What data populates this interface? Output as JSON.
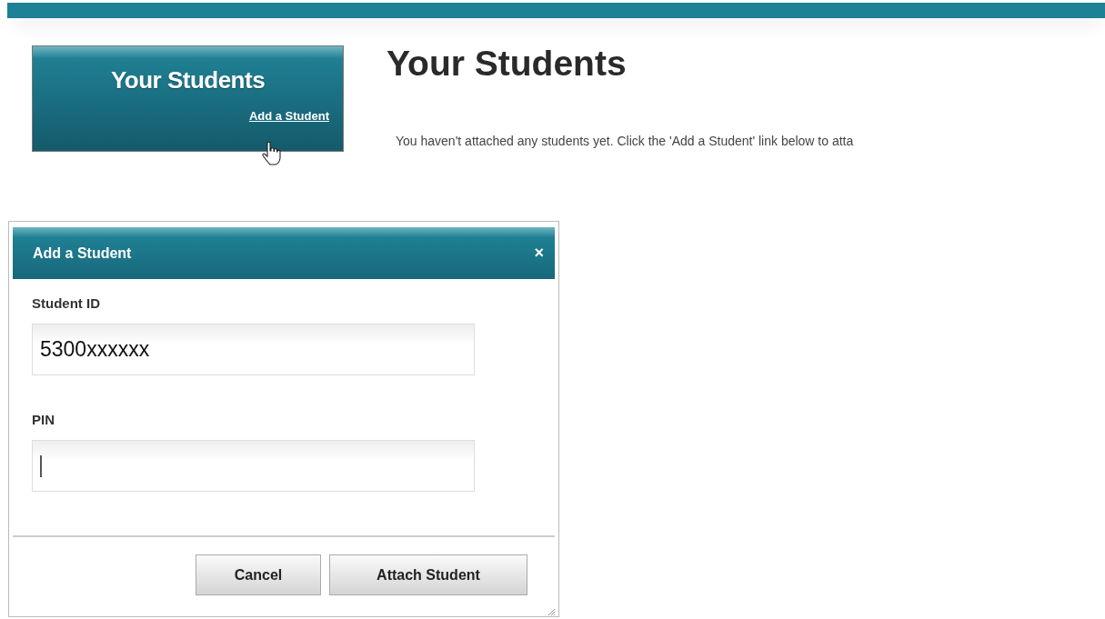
{
  "sidebar": {
    "title": "Your Students",
    "link": "Add a Student"
  },
  "main": {
    "heading": "Your Students",
    "message": "You haven't attached any students yet. Click the 'Add a Student' link below to atta"
  },
  "dialog": {
    "title": "Add a Student",
    "close": "×",
    "fields": [
      {
        "label": "Student ID",
        "value": "5300xxxxxx",
        "focused": false
      },
      {
        "label": "PIN",
        "focused": true
      }
    ],
    "buttons": [
      "Cancel",
      "Attach Student"
    ]
  }
}
